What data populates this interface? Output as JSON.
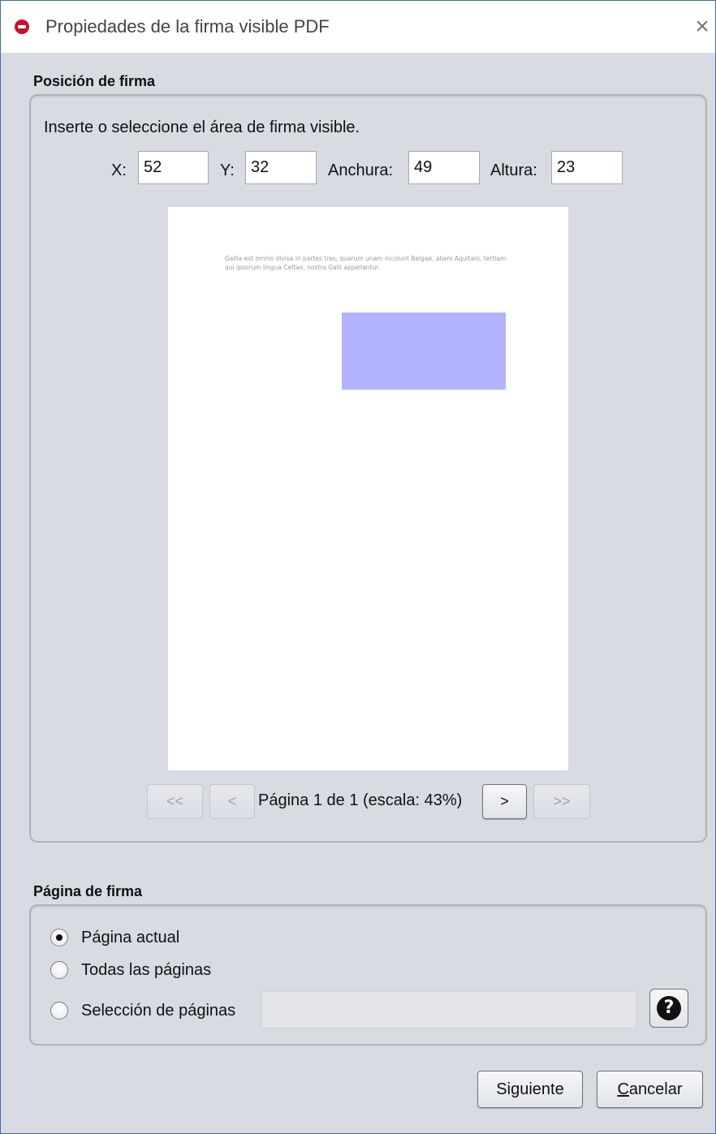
{
  "window": {
    "title": "Propiedades de la firma visible PDF",
    "close_label": "×"
  },
  "position_section": {
    "label": "Posición de firma",
    "instruction": "Inserte o seleccione el área de firma visible.",
    "fields": {
      "x": {
        "label": "X:",
        "value": "52"
      },
      "y": {
        "label": "Y:",
        "value": "32"
      },
      "width": {
        "label": "Anchura:",
        "value": "49"
      },
      "height": {
        "label": "Altura:",
        "value": "23"
      }
    },
    "preview": {
      "document_text": "Gallia est omnis divisa in partes tres, quarum unam incolunt Belgae, aliam Aquitani, tertiam qui ipsorum lingua Celtae, nostra Galli appellantur.",
      "signature_area_color": "#b2b2ff"
    },
    "navigation": {
      "first_label": "<<",
      "prev_label": "<",
      "page_info": "Página 1 de 1 (escala: 43%)",
      "next_label": ">",
      "last_label": ">>"
    }
  },
  "page_section": {
    "label": "Página de firma",
    "options": [
      {
        "label": "Página actual",
        "selected": true
      },
      {
        "label": "Todas las páginas",
        "selected": false
      },
      {
        "label": "Selección de páginas",
        "selected": false
      }
    ],
    "pages_input_value": "",
    "help_icon": "question-icon"
  },
  "buttons": {
    "next_label": "Siguiente",
    "cancel_mnemonic": "C",
    "cancel_rest": "ancelar"
  },
  "colors": {
    "window_background": "#d8dbe2",
    "accent_border": "#3f6fb0",
    "app_icon": "#c8102e"
  }
}
